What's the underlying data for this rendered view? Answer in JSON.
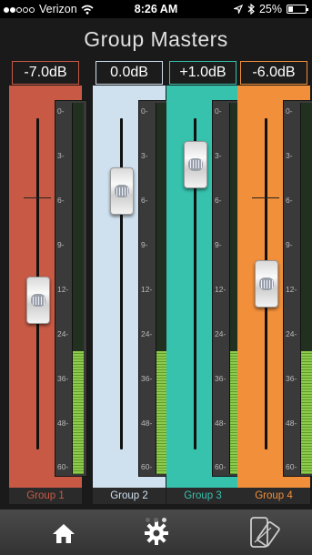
{
  "status_bar": {
    "carrier": "Verizon",
    "time": "8:26 AM",
    "battery": "25%",
    "battery_level": 0.25,
    "signal_bars": 2
  },
  "page_title": "Group Masters",
  "meter_scale": [
    "0-",
    "3-",
    "6-",
    "9-",
    "12-",
    "24-",
    "36-",
    "48-",
    "60-"
  ],
  "groups": [
    {
      "name": "Group 1",
      "db": "-7.0dB",
      "color": "#c85a45",
      "meter_level": 0.33,
      "fader": 0.45
    },
    {
      "name": "Group 2",
      "db": "0.0dB",
      "color": "#cfe0ef",
      "meter_level": 0.33,
      "fader": 0.78
    },
    {
      "name": "Group 3",
      "db": "+1.0dB",
      "color": "#36c2ad",
      "meter_level": 0.33,
      "fader": 0.86
    },
    {
      "name": "Group 4",
      "db": "-6.0dB",
      "color": "#f18f3a",
      "meter_level": 0.33,
      "fader": 0.5
    }
  ],
  "pager": {
    "count": 3,
    "active": 2
  },
  "toolbar": {
    "home": "home-icon",
    "settings": "gear-icon",
    "device": "phone-tablet-icon"
  }
}
